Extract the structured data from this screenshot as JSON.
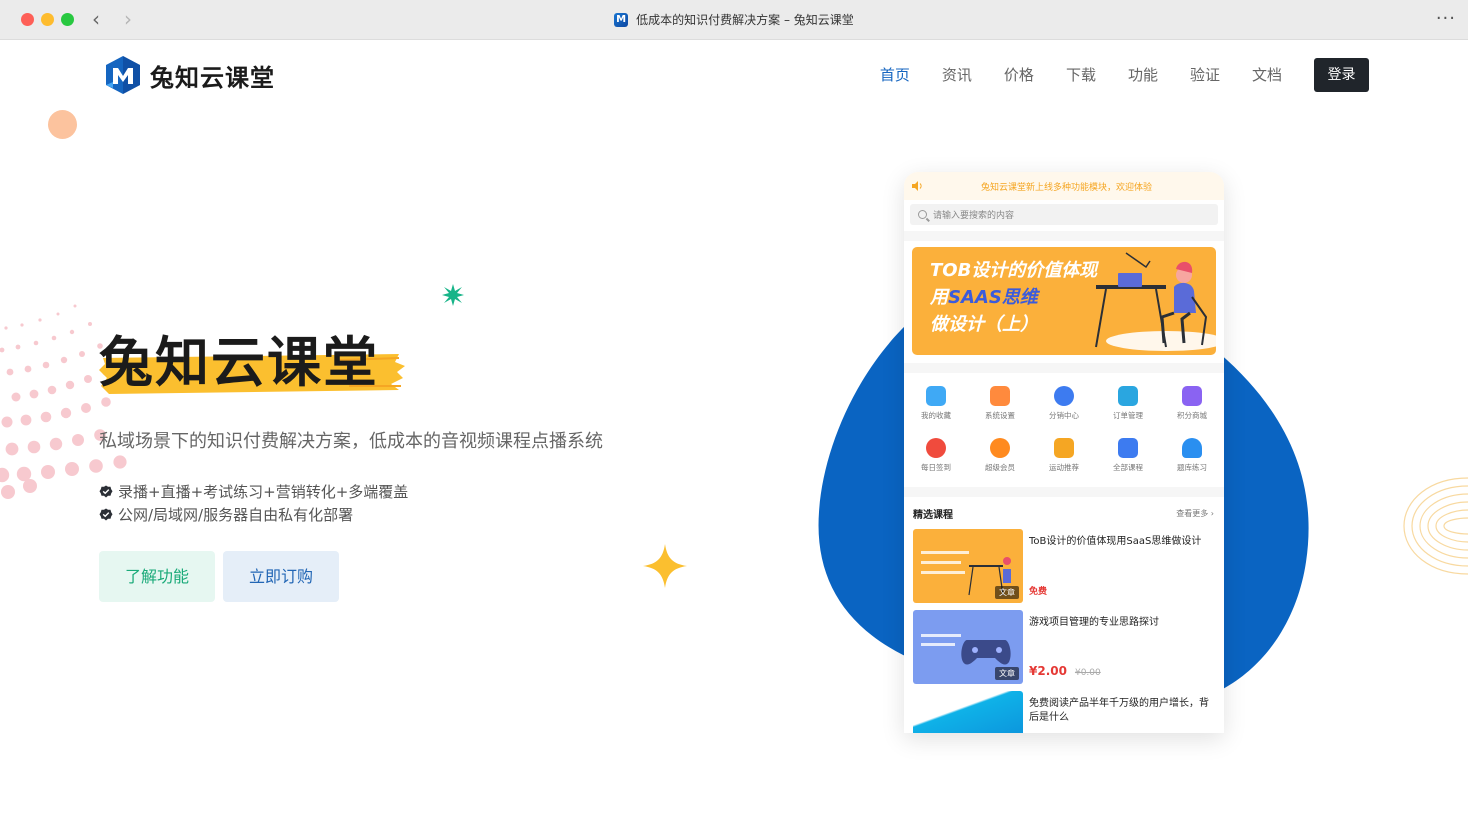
{
  "window": {
    "tab_title": "低成本的知识付费解决方案 – 兔知云课堂",
    "back_glyph": "‹",
    "forward_glyph": "›",
    "more_glyph": "···"
  },
  "header": {
    "logo_text": "兔知云课堂",
    "nav": [
      {
        "label": "首页",
        "active": true
      },
      {
        "label": "资讯"
      },
      {
        "label": "价格"
      },
      {
        "label": "下载"
      },
      {
        "label": "功能"
      },
      {
        "label": "验证"
      },
      {
        "label": "文档"
      }
    ],
    "login_label": "登录"
  },
  "hero": {
    "title": "兔知云课堂",
    "subtitle": "私域场景下的知识付费解决方案，低成本的音视频课程点播系统",
    "features": [
      "录播+直播+考试练习+营销转化+多端覆盖",
      "公网/局域网/服务器自由私有化部署"
    ],
    "learn_button": "了解功能",
    "buy_button": "立即订购"
  },
  "phone": {
    "notice": "兔知云课堂新上线多种功能模块，欢迎体验",
    "search_placeholder": "请输入要搜索的内容",
    "banner_lines": [
      "TOB设计的价值体现",
      "用",
      "SAAS思维",
      "做设计（上）"
    ],
    "grid": [
      {
        "label": "我的收藏",
        "color": "#3fa9f5"
      },
      {
        "label": "系统设置",
        "color": "#ff8a3d"
      },
      {
        "label": "分销中心",
        "color": "#3d7bf0"
      },
      {
        "label": "订单管理",
        "color": "#2aa6e0"
      },
      {
        "label": "积分商城",
        "color": "#8a63f2"
      },
      {
        "label": "每日签到",
        "color": "#f04b3d"
      },
      {
        "label": "超级会员",
        "color": "#ff8a1f"
      },
      {
        "label": "运动推荐",
        "color": "#f5a623"
      },
      {
        "label": "全部课程",
        "color": "#3d7bf0"
      },
      {
        "label": "题库练习",
        "color": "#2a8ff0"
      }
    ],
    "section_title": "精选课程",
    "section_more": "查看更多 ›",
    "courses": [
      {
        "title": "ToB设计的价值体现用SaaS思维做设计",
        "tag": "文章",
        "free": "免费"
      },
      {
        "title": "游戏项目管理的专业思路探讨",
        "tag": "文章",
        "price": "¥2.00",
        "old_price": "¥0.00"
      },
      {
        "title": "免费阅读产品半年千万级的用户增长，背后是什么"
      }
    ]
  }
}
